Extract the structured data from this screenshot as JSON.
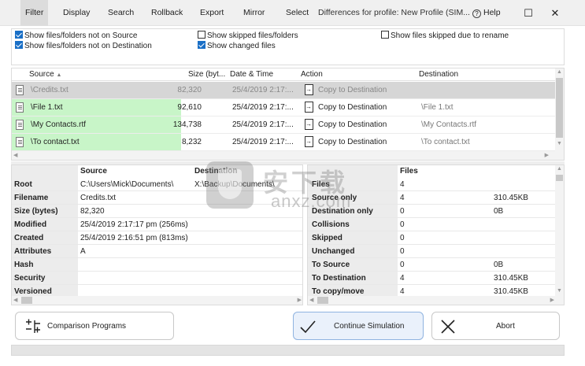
{
  "menu": {
    "items": [
      "Filter",
      "Display",
      "Search",
      "Rollback",
      "Export",
      "Mirror",
      "Select"
    ],
    "active_index": 0,
    "title": "Differences for profile: New Profile (SIM...",
    "help_label": "Help",
    "minimize": "☐",
    "close": "✕"
  },
  "filters": {
    "not_on_source": "Show files/folders not on Source",
    "not_on_destination": "Show files/folders not on Destination",
    "skipped": "Show skipped files/folders",
    "changed": "Show changed files",
    "skipped_rename": "Show files skipped due to rename",
    "checked": {
      "not_on_source": true,
      "not_on_destination": true,
      "skipped": false,
      "changed": true,
      "skipped_rename": false
    }
  },
  "file_list": {
    "columns": {
      "source": "Source",
      "size": "Size (byt...",
      "date": "Date & Time",
      "action": "Action",
      "destination": "Destination"
    },
    "sort_indicator": "▲",
    "rows": [
      {
        "source": "\\Credits.txt",
        "size": "82,320",
        "date": "25/4/2019 2:17:...",
        "action": "Copy to Destination",
        "destination": ""
      },
      {
        "source": "\\File 1.txt",
        "size": "92,610",
        "date": "25/4/2019 2:17:...",
        "action": "Copy to Destination",
        "destination": "\\File 1.txt"
      },
      {
        "source": "\\My Contacts.rtf",
        "size": "134,738",
        "date": "25/4/2019 2:17:...",
        "action": "Copy to Destination",
        "destination": "\\My Contacts.rtf"
      },
      {
        "source": "\\To contact.txt",
        "size": "8,232",
        "date": "25/4/2019 2:17:...",
        "action": "Copy to Destination",
        "destination": "\\To contact.txt"
      }
    ]
  },
  "properties": {
    "headers": {
      "source": "Source",
      "destination": "Destination"
    },
    "rows": [
      {
        "label": "Root",
        "source": "C:\\Users\\Mick\\Documents\\",
        "destination": "X:\\Backup\\Documents\\"
      },
      {
        "label": "Filename",
        "source": "Credits.txt",
        "destination": ""
      },
      {
        "label": "Size (bytes)",
        "source": "82,320",
        "destination": ""
      },
      {
        "label": "Modified",
        "source": "25/4/2019 2:17:17 pm (256ms)",
        "destination": ""
      },
      {
        "label": "Created",
        "source": "25/4/2019 2:16:51 pm (813ms)",
        "destination": ""
      },
      {
        "label": "Attributes",
        "source": "A",
        "destination": ""
      },
      {
        "label": "Hash",
        "source": "",
        "destination": ""
      },
      {
        "label": "Security",
        "source": "",
        "destination": ""
      },
      {
        "label": "Versioned",
        "source": "",
        "destination": ""
      }
    ]
  },
  "stats": {
    "header": "Files",
    "rows": [
      {
        "label": "Files",
        "count": "4",
        "size": ""
      },
      {
        "label": "Source only",
        "count": "4",
        "size": "310.45KB"
      },
      {
        "label": "Destination only",
        "count": "0",
        "size": "0B"
      },
      {
        "label": "Collisions",
        "count": "0",
        "size": ""
      },
      {
        "label": "Skipped",
        "count": "0",
        "size": ""
      },
      {
        "label": "Unchanged",
        "count": "0",
        "size": ""
      },
      {
        "label": "To Source",
        "count": "0",
        "size": "0B"
      },
      {
        "label": "To Destination",
        "count": "4",
        "size": "310.45KB"
      },
      {
        "label": "To copy/move",
        "count": "4",
        "size": "310.45KB"
      }
    ]
  },
  "buttons": {
    "comparison": "Comparison Programs",
    "continue": "Continue Simulation",
    "abort": "Abort"
  },
  "watermark": {
    "big": "安下载",
    "small": "anxz.com"
  },
  "colors": {
    "new_file_bg": "#c8f5c8",
    "selected_row_bg": "#d6d6d6",
    "primary_button_bg": "#eaf1fb"
  }
}
